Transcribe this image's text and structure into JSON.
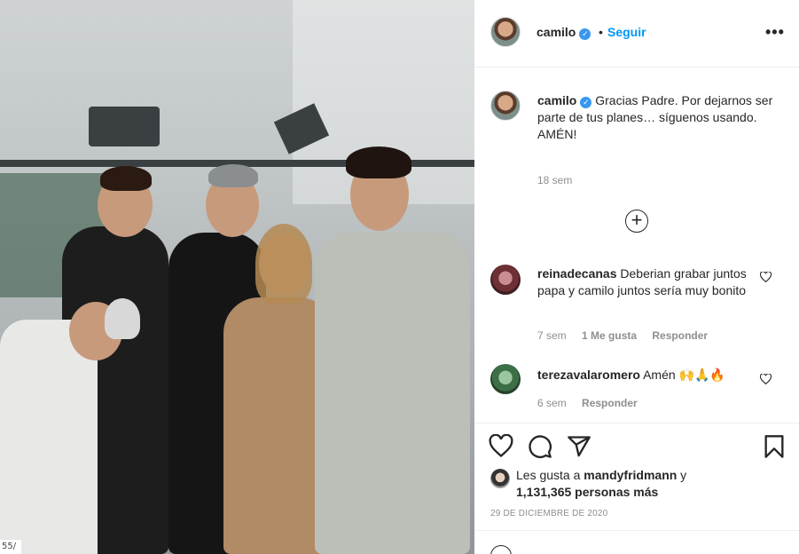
{
  "post": {
    "username": "camilo",
    "follow_label": "Seguir",
    "dot": "•",
    "more_label": "•••"
  },
  "caption": {
    "username": "camilo",
    "text": "Gracias Padre. Por dejarnos ser parte de tus planes… síguenos usando.",
    "text2": "AMÉN!",
    "time": "18 sem"
  },
  "load_more_label": "+",
  "comments": [
    {
      "username": "reinadecanas",
      "text": "Deberian grabar juntos papa y camilo juntos sería muy bonito",
      "time": "7 sem",
      "likes": "1 Me gusta",
      "reply": "Responder"
    },
    {
      "username": "terezavalaromero",
      "text": "Amén 🙌🙏🔥",
      "time": "6 sem",
      "reply": "Responder"
    }
  ],
  "likes": {
    "prefix": "Les gusta a ",
    "user": "mandyfridmann",
    "mid": " y",
    "count": "1,131,365 personas más"
  },
  "date": "29 DE DICIEMBRE DE 2020",
  "photo_watermark": "55/",
  "colors": {
    "accent": "#0095f6",
    "verified": "#3897f0",
    "text": "#262626",
    "muted": "#8e8e8e"
  },
  "icons": {
    "verified": "verified-badge-icon",
    "heart": "heart-icon",
    "comment": "comment-icon",
    "share": "paper-plane-icon",
    "save": "bookmark-icon",
    "add": "plus-circle-icon",
    "emoji": "emoji-icon"
  }
}
